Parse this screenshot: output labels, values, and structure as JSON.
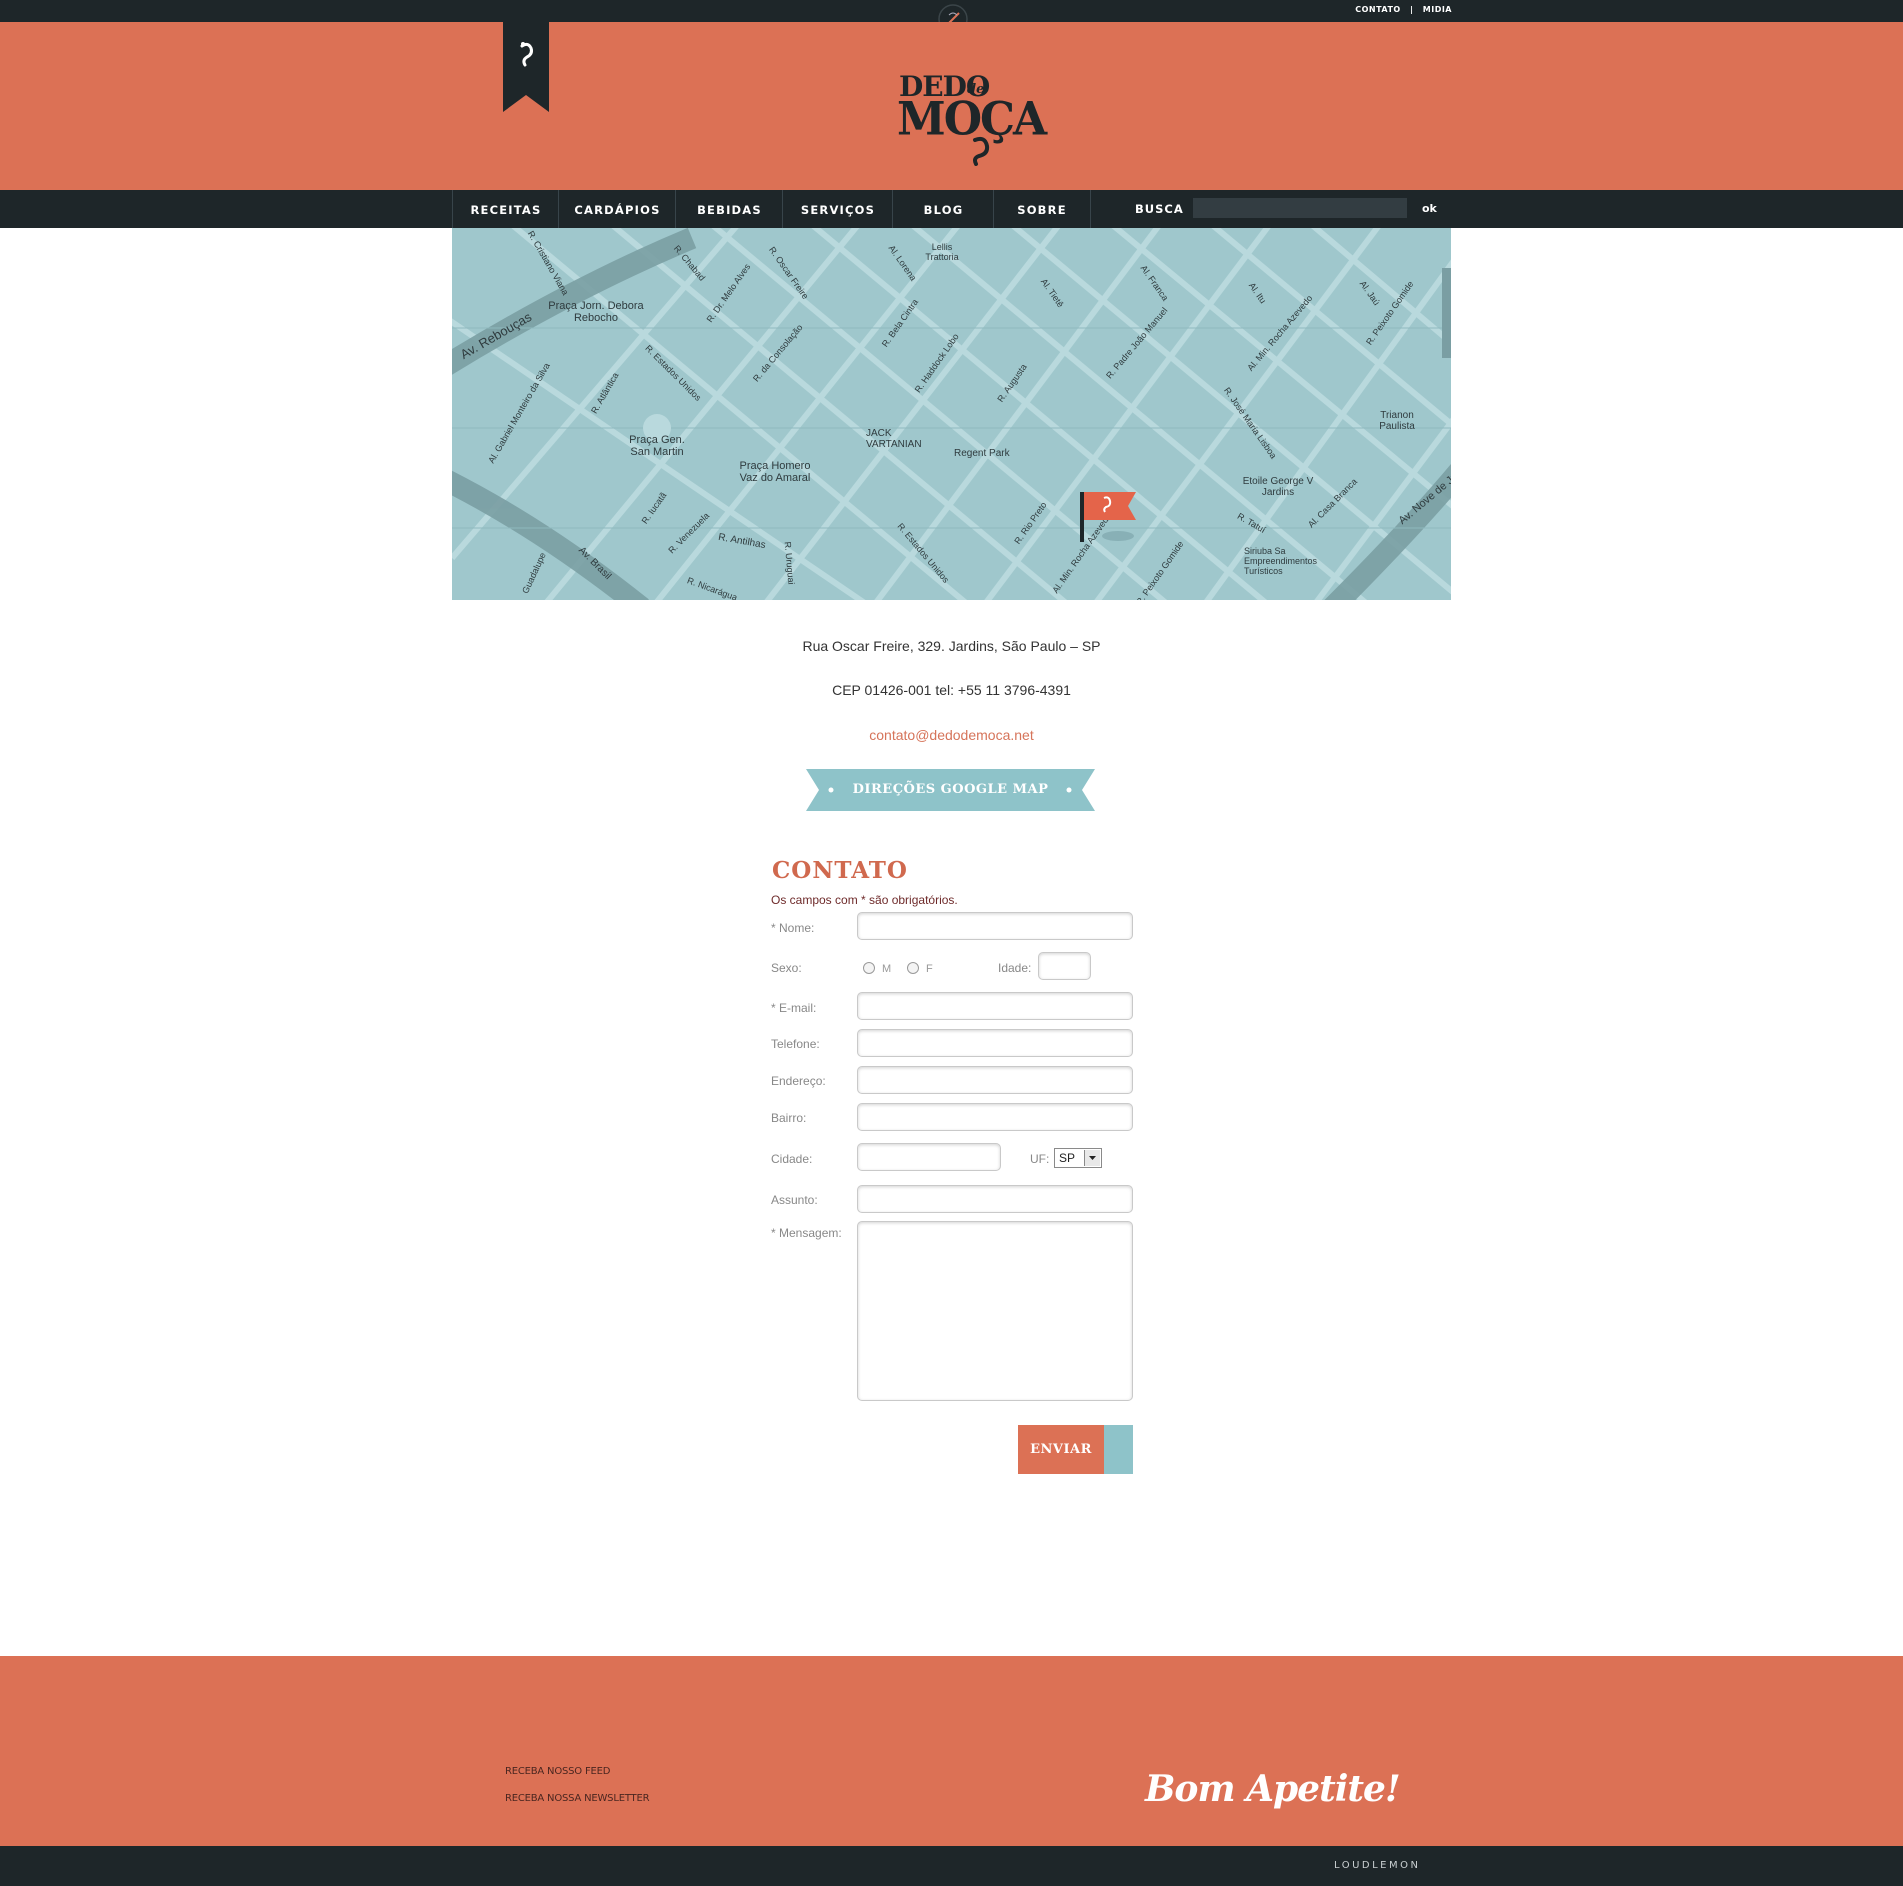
{
  "top_links": {
    "contato": "CONTATO",
    "separator": "|",
    "midia": "MIDIA"
  },
  "logo": {
    "line1": "DEDO",
    "line1_small": "de",
    "line2": "MOÇA"
  },
  "nav": {
    "items": [
      "RECEITAS",
      "CARDÁPIOS",
      "BEBIDAS",
      "SERVIÇOS",
      "BLOG",
      "SOBRE"
    ],
    "search_label": "BUSCA",
    "search_value": "",
    "search_button": "ok"
  },
  "map": {
    "labels": [
      "Av. Rebouças",
      "R. Cristiano Viana",
      "Praça Jorn. Debora Rebocho",
      "R. Chabad",
      "R. Dr. Melo Alves",
      "R. Oscar Freire",
      "Al. Lorena",
      "Lellis Trattoria",
      "R. Bela Cintra",
      "Al. Tietê",
      "Al. Franca",
      "Al. Itu",
      "Al. Jaú",
      "R. Peixoto Gomide",
      "Al. Gabriel Monteiro da Silva",
      "R. Atlântica",
      "R. Estados Unidos",
      "R. da Consolação",
      "R. Haddock Lobo",
      "R. Augusta",
      "R. Padre João Manuel",
      "Al. Min. Rocha Azevedo",
      "Praça Gen. San Martin",
      "Praça Homero Vaz do Amaral",
      "JACK VARTANIAN",
      "Regent Park",
      "R. José Maria Lisboa",
      "Trianon Paulista",
      "Etoile George V Jardins",
      "R. Iucatã",
      "R. Venezuela",
      "R. Antilhas",
      "R. Uruguai",
      "R. Rio Preto",
      "R. Tatuí",
      "Al. Casa Branca",
      "Av. Nove de Julho",
      "Av. Brasil",
      "Guadalupe",
      "R. Nicarágua",
      "Siriuba Sa Empreendimentos Turísticos",
      "Al. Min. Rocha Azevedo",
      "R. Estados Unidos",
      "R. Peixoto Gomide"
    ]
  },
  "address": {
    "line1": "Rua Oscar Freire, 329. Jardins, São Paulo – SP",
    "line2": "CEP 01426-001 tel: +55 11 3796-4391",
    "email": "contato@dedodemoca.net",
    "directions_button": "DIREÇÕES GOOGLE MAP"
  },
  "form": {
    "title": "CONTATO",
    "required_note": "Os campos com * são obrigatórios.",
    "labels": {
      "nome": "* Nome:",
      "sexo": "Sexo:",
      "idade": "Idade:",
      "email": "* E-mail:",
      "telefone": "Telefone:",
      "endereco": "Endereço:",
      "bairro": "Bairro:",
      "cidade": "Cidade:",
      "uf": "UF:",
      "assunto": "Assunto:",
      "mensagem": "* Mensagem:"
    },
    "sexo_options": [
      "M",
      "F"
    ],
    "uf_value": "SP",
    "submit": "ENVIAR"
  },
  "footer": {
    "feed": "RECEBA NOSSO FEED",
    "newsletter": "RECEBA NOSSA NEWSLETTER",
    "tagline": "Bom Apetite!",
    "credit": "LOUDLEMON"
  },
  "colors": {
    "brand_coral": "#dc7155",
    "dark": "#1e2629",
    "map_teal": "#9fc7cc",
    "accent_blue": "#8ec3c9"
  }
}
